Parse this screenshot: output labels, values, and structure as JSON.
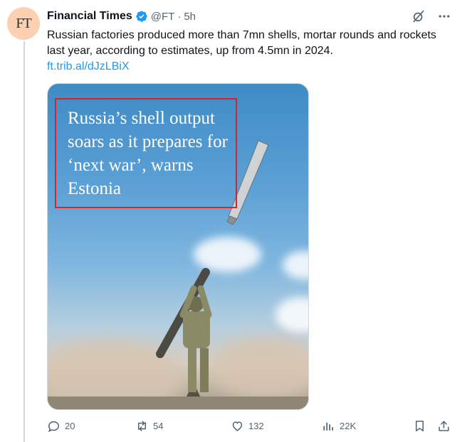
{
  "post": {
    "avatar_text": "FT",
    "author_name": "Financial Times",
    "handle": "@FT",
    "separator": "·",
    "time": "5h",
    "body": "Russian factories produced more than 7mn shells, mortar rounds and rockets last year, according to estimates, up from 4.5mn in 2024.",
    "link": "ft.trib.al/dJzLBiX"
  },
  "media": {
    "headline": "Russia’s shell output soars as it prepares for ‘next war’, warns Estonia"
  },
  "actions": {
    "replies": "20",
    "reposts": "54",
    "likes": "132",
    "views": "22K"
  },
  "icons": [
    "verified-badge-icon",
    "grok-icon",
    "more-icon",
    "reply-icon",
    "repost-icon",
    "like-icon",
    "views-icon",
    "bookmark-icon",
    "share-icon"
  ],
  "colors": {
    "link": "#1d9bf0",
    "verified": "#1d9bf0",
    "muted": "#536471",
    "annotation_box": "#d3262f",
    "avatar_bg": "#fcd0b1"
  }
}
